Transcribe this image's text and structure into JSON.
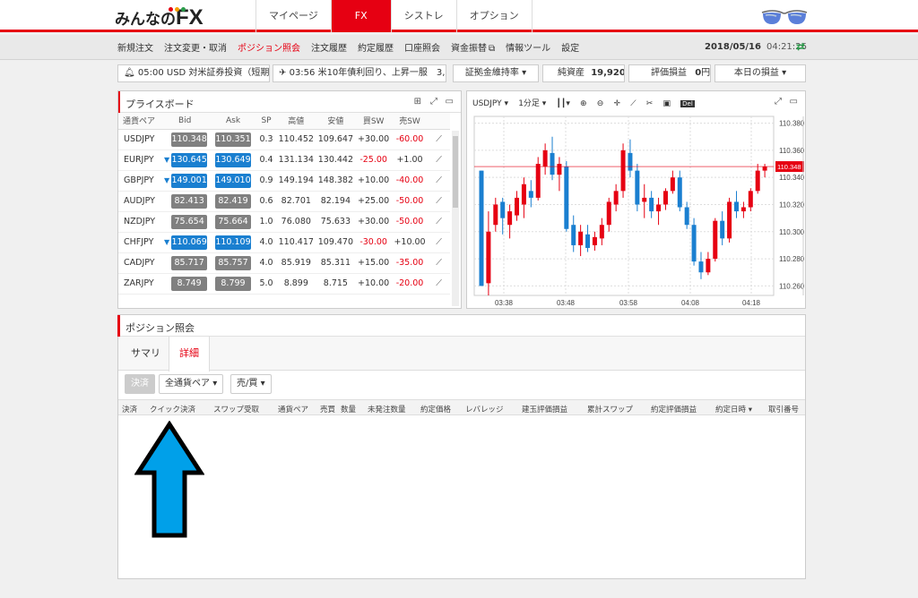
{
  "app": {
    "logo_text": "みんなの",
    "logo_fx": "FX"
  },
  "nav": {
    "tabs": [
      "マイページ",
      "FX",
      "シストレ",
      "オプション"
    ]
  },
  "menu": {
    "items": [
      "新規注文",
      "注文変更・取消",
      "ポジション照会",
      "注文履歴",
      "約定履歴",
      "口座照会",
      "資金振替",
      "情報ツール",
      "設定"
    ]
  },
  "datetime": {
    "date": "2018/05/16",
    "time": "04:21:26"
  },
  "tickers": {
    "news1": "05:00 USD 対米証券投資（短期…",
    "news2": "03:56 米10年債利回り、上昇一服　3,…",
    "margin_label": "証拠金維持率 ▾",
    "net_assets_label": "純資産",
    "net_assets_value": "19,920",
    "net_assets_unit": "円",
    "eval_label": "評価損益",
    "eval_value": "0",
    "eval_unit": "円",
    "today_label": "本日の損益 ▾"
  },
  "price_board": {
    "title": "プライスボード",
    "headers": [
      "通貨ペア",
      "Bid",
      "Ask",
      "SP",
      "高値",
      "安値",
      "買SW",
      "売SW"
    ],
    "rows": [
      [
        "USDJPY",
        "110.348",
        "110.351",
        "0.3",
        "110.452",
        "109.647",
        "+30.00",
        "-60.00"
      ],
      [
        "EURJPY",
        "130.645",
        "130.649",
        "0.4",
        "131.134",
        "130.442",
        "-25.00",
        "+1.00"
      ],
      [
        "GBPJPY",
        "149.001",
        "149.010",
        "0.9",
        "149.194",
        "148.382",
        "+10.00",
        "-40.00"
      ],
      [
        "AUDJPY",
        "82.413",
        "82.419",
        "0.6",
        "82.701",
        "82.194",
        "+25.00",
        "-50.00"
      ],
      [
        "NZDJPY",
        "75.654",
        "75.664",
        "1.0",
        "76.080",
        "75.633",
        "+30.00",
        "-50.00"
      ],
      [
        "CHFJPY",
        "110.069",
        "110.109",
        "4.0",
        "110.417",
        "109.470",
        "-30.00",
        "+10.00"
      ],
      [
        "CADJPY",
        "85.717",
        "85.757",
        "4.0",
        "85.919",
        "85.311",
        "+15.00",
        "-35.00"
      ],
      [
        "ZARJPY",
        "8.749",
        "8.799",
        "5.0",
        "8.899",
        "8.715",
        "+10.00",
        "-20.00"
      ]
    ]
  },
  "chart_toolbar": {
    "symbol": "USDJPY ▾",
    "timeframe": "1分足 ▾"
  },
  "chart_data": {
    "type": "candlestick",
    "symbol": "USDJPY",
    "timeframe": "1分足",
    "x_ticks": [
      "03:38",
      "03:48",
      "03:58",
      "04:08",
      "04:18"
    ],
    "y_ticks": [
      "110.380",
      "110.360",
      "110.340",
      "110.320",
      "110.300",
      "110.280",
      "110.260"
    ],
    "ylim": [
      110.253,
      110.385
    ],
    "current_price": "110.348",
    "candles": [
      [
        110.345,
        110.345,
        110.26,
        110.26
      ],
      [
        110.262,
        110.315,
        110.253,
        110.3
      ],
      [
        110.305,
        110.325,
        110.3,
        110.32
      ],
      [
        110.322,
        110.325,
        110.298,
        110.31
      ],
      [
        110.305,
        110.32,
        110.295,
        110.315
      ],
      [
        110.312,
        110.33,
        110.308,
        110.325
      ],
      [
        110.32,
        110.34,
        110.31,
        110.335
      ],
      [
        110.33,
        110.338,
        110.318,
        110.325
      ],
      [
        110.325,
        110.355,
        110.323,
        110.35
      ],
      [
        110.348,
        110.365,
        110.342,
        110.36
      ],
      [
        110.358,
        110.37,
        110.338,
        110.342
      ],
      [
        110.342,
        110.355,
        110.33,
        110.35
      ],
      [
        110.348,
        110.352,
        110.3,
        110.302
      ],
      [
        110.305,
        110.312,
        110.285,
        110.29
      ],
      [
        110.29,
        110.305,
        110.282,
        110.3
      ],
      [
        110.298,
        110.305,
        110.285,
        110.288
      ],
      [
        110.29,
        110.3,
        110.286,
        110.296
      ],
      [
        110.295,
        110.31,
        110.29,
        110.305
      ],
      [
        110.305,
        110.325,
        110.3,
        110.322
      ],
      [
        110.32,
        110.335,
        110.315,
        110.33
      ],
      [
        110.33,
        110.365,
        110.325,
        110.36
      ],
      [
        110.358,
        110.368,
        110.34,
        110.345
      ],
      [
        110.345,
        110.35,
        110.315,
        110.32
      ],
      [
        110.322,
        110.335,
        110.31,
        110.325
      ],
      [
        110.325,
        110.33,
        110.31,
        110.315
      ],
      [
        110.315,
        110.325,
        110.305,
        110.32
      ],
      [
        110.32,
        110.332,
        110.316,
        110.33
      ],
      [
        110.33,
        110.345,
        110.328,
        110.34
      ],
      [
        110.34,
        110.345,
        110.315,
        110.318
      ],
      [
        110.318,
        110.322,
        110.302,
        110.305
      ],
      [
        110.305,
        110.31,
        110.275,
        110.278
      ],
      [
        110.278,
        110.285,
        110.265,
        110.27
      ],
      [
        110.27,
        110.285,
        110.268,
        110.28
      ],
      [
        110.28,
        110.31,
        110.278,
        110.308
      ],
      [
        110.308,
        110.315,
        110.29,
        110.295
      ],
      [
        110.295,
        110.325,
        110.292,
        110.322
      ],
      [
        110.322,
        110.33,
        110.31,
        110.315
      ],
      [
        110.315,
        110.322,
        110.31,
        110.318
      ],
      [
        110.318,
        110.332,
        110.315,
        110.33
      ],
      [
        110.33,
        110.35,
        110.328,
        110.345
      ],
      [
        110.345,
        110.35,
        110.34,
        110.348
      ]
    ]
  },
  "positions": {
    "title": "ポジション照会",
    "tabs": [
      "サマリ",
      "詳細"
    ],
    "settle_btn": "決済",
    "pair_filter": "全通貨ペア",
    "side_filter": "売/買",
    "columns": [
      "決済",
      "クイック決済",
      "スワップ受取",
      "通貨ペア",
      "売買",
      "数量",
      "未発注数量",
      "約定価格",
      "レバレッジ",
      "建玉評価損益",
      "累計スワップ",
      "約定評価損益",
      "約定日時 ▾",
      "取引番号"
    ]
  },
  "colors": {
    "brand_red": "#e60012",
    "bid_blue": "#1a7fd0",
    "gray_price": "#808080",
    "arrow_blue": "#00a0e9"
  }
}
